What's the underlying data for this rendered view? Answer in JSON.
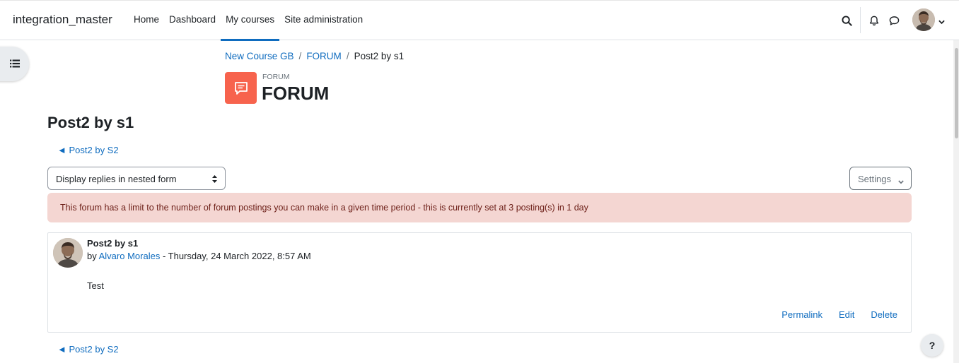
{
  "navbar": {
    "brand": "integration_master",
    "items": [
      {
        "label": "Home",
        "active": false
      },
      {
        "label": "Dashboard",
        "active": false
      },
      {
        "label": "My courses",
        "active": true
      },
      {
        "label": "Site administration",
        "active": false
      }
    ],
    "icons": [
      "search-icon",
      "bell-icon",
      "message-icon",
      "avatar",
      "chevron-down-icon"
    ]
  },
  "breadcrumb": {
    "items": [
      "New Course GB",
      "FORUM"
    ],
    "current": "Post2 by s1"
  },
  "module": {
    "type_label": "FORUM",
    "title": "FORUM",
    "icon": "forum-icon",
    "accent": "#f7634d"
  },
  "page": {
    "heading": "Post2 by s1",
    "prev_link_top": "◄ Post2 by S2",
    "prev_link_bottom": "◄ Post2 by S2"
  },
  "controls": {
    "display_mode": "Display replies in nested form",
    "settings_label": "Settings"
  },
  "alert": {
    "text": "This forum has a limit to the number of forum postings you can make in a given time period - this is currently set at 3 posting(s) in 1 day",
    "color": "#f4d6d2"
  },
  "post": {
    "subject": "Post2 by s1",
    "by_prefix": "by ",
    "author": "Alvaro Morales",
    "date": " - Thursday, 24 March 2022, 8:57 AM",
    "content": "Test",
    "actions": [
      "Permalink",
      "Edit",
      "Delete"
    ]
  },
  "help": {
    "label": "?"
  },
  "colors": {
    "link": "#0f6cbf",
    "text": "#1d2125"
  }
}
